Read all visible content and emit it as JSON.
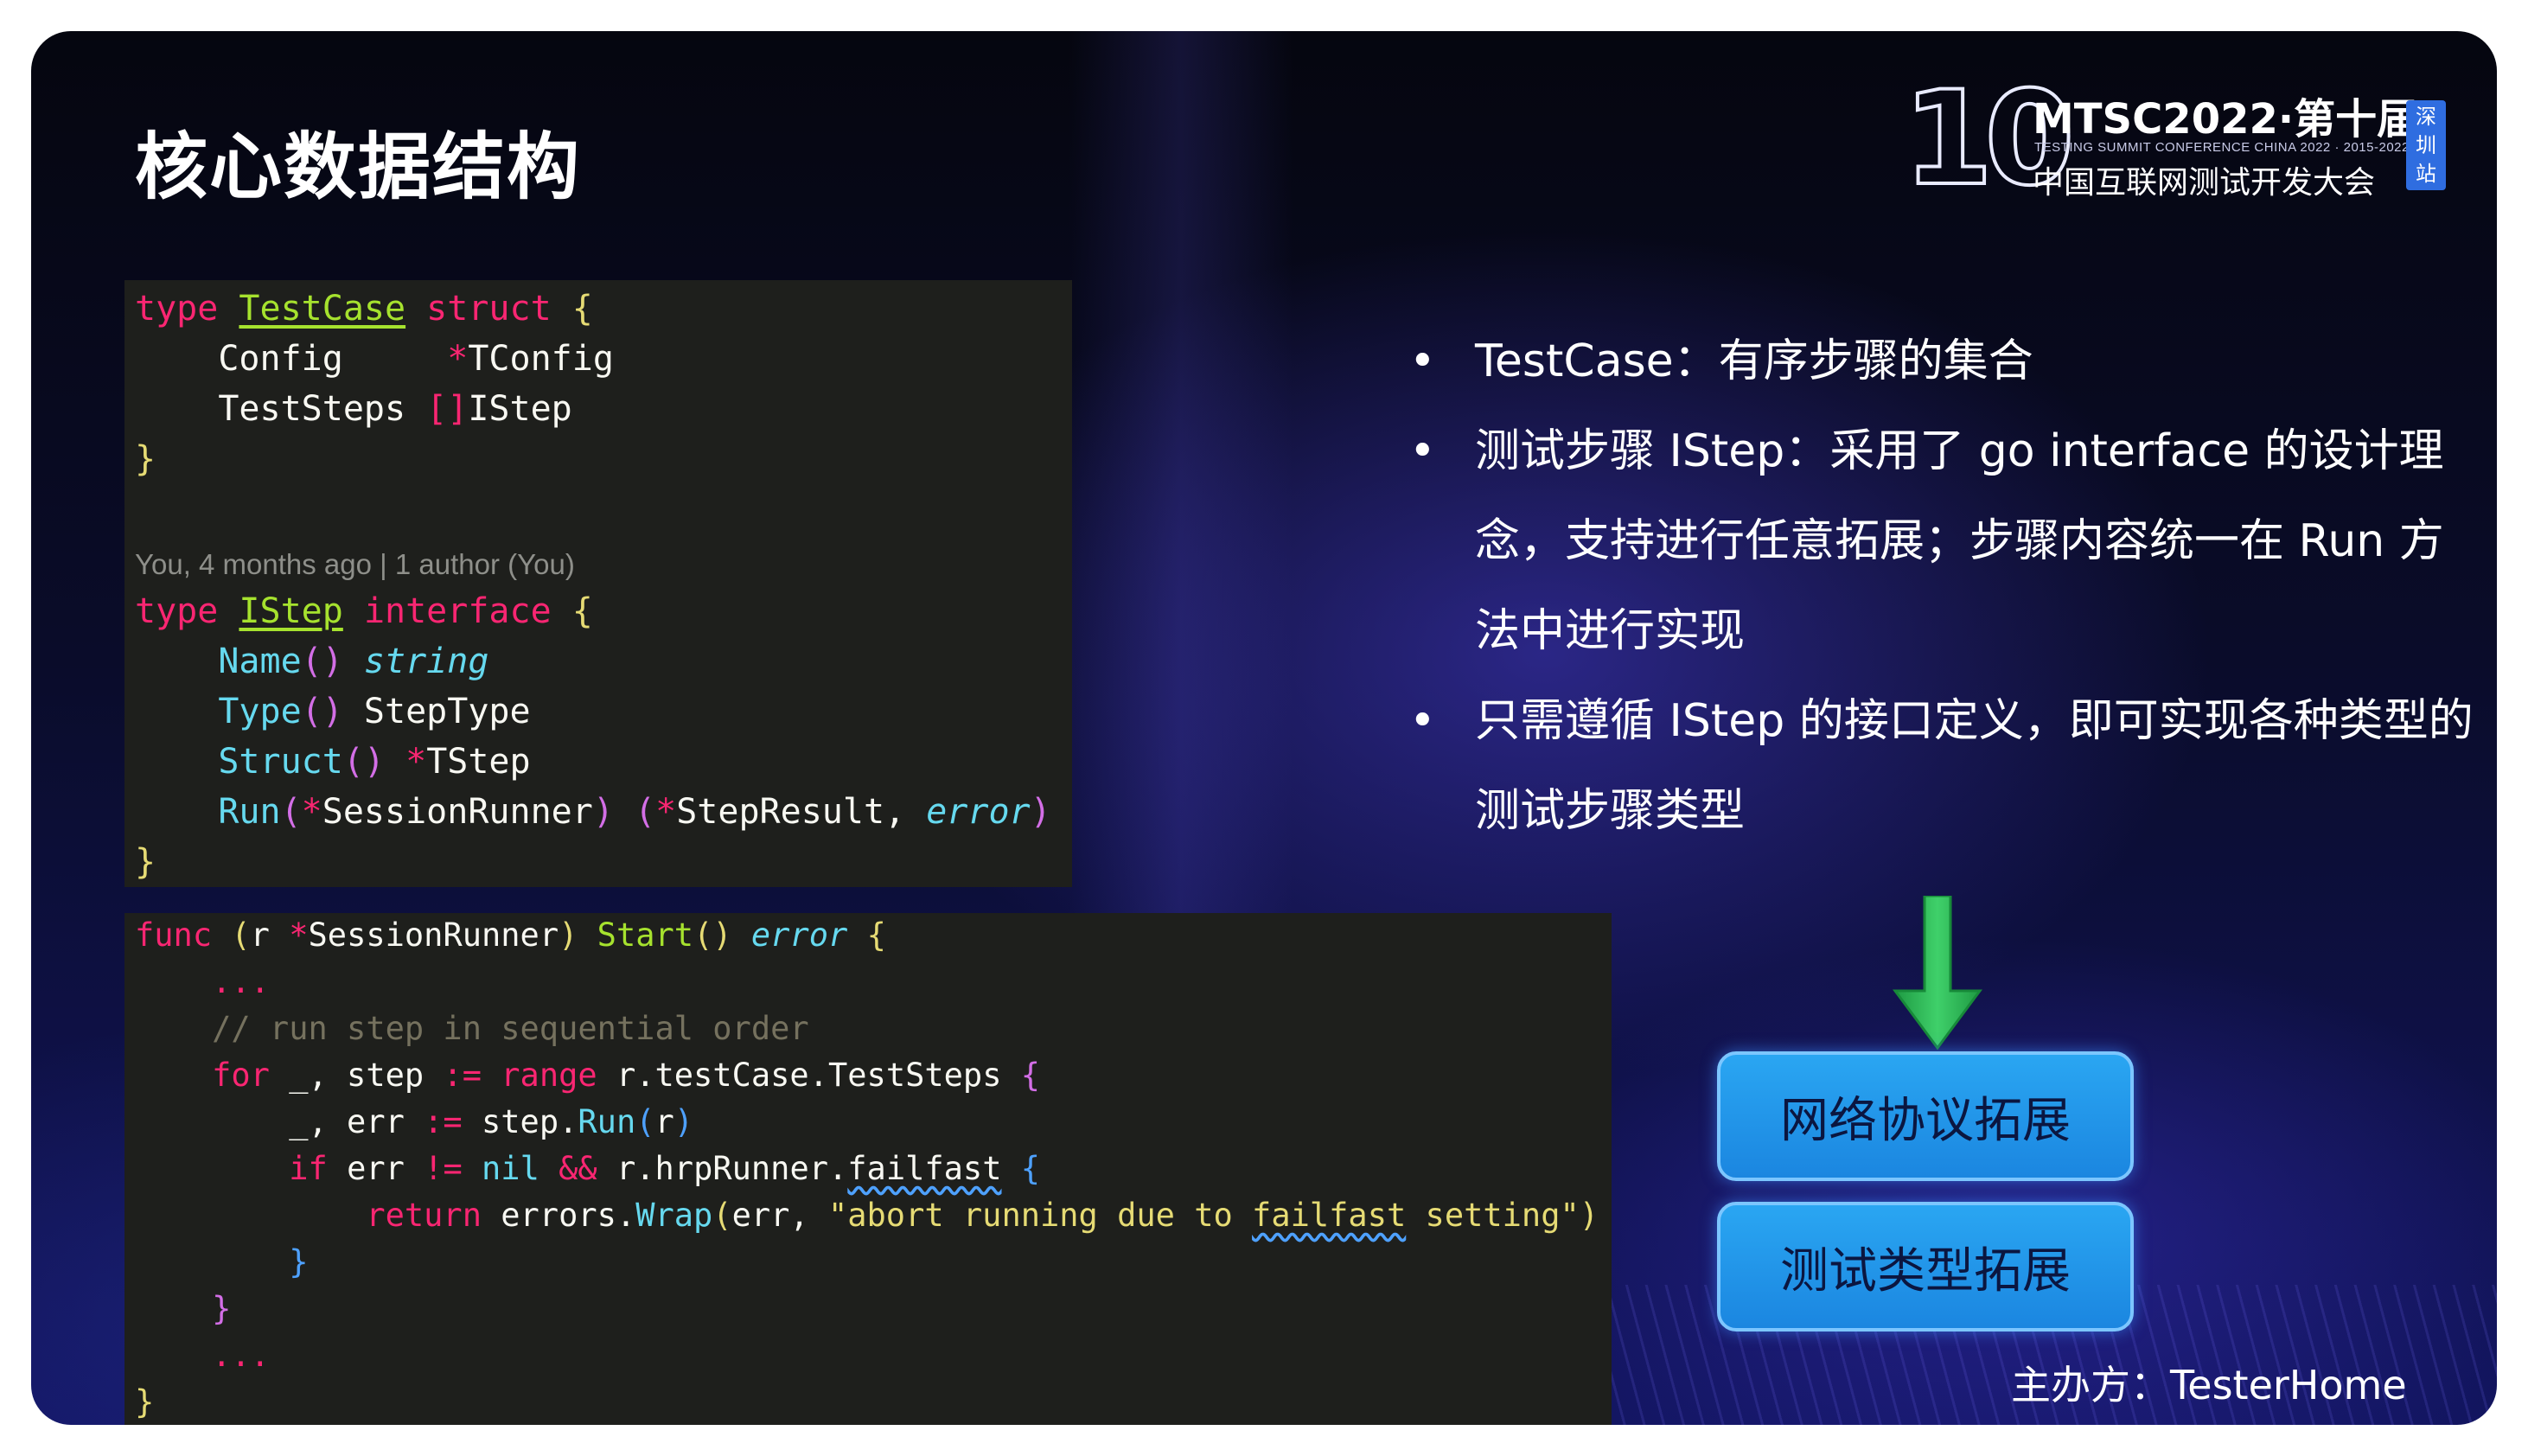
{
  "slide": {
    "title": "核心数据结构",
    "logo": {
      "brand": "MTSC2022·第十届",
      "tagline": "TESTING SUMMIT CONFERENCE CHINA 2022 · 2015-2022",
      "cn_name": "中国互联网测试开发大会",
      "edition_mark": "10",
      "badge": [
        "深",
        "圳",
        "站"
      ]
    },
    "code_testcase": {
      "lines": [
        {
          "kw": "type",
          "name": "TestCase",
          "kw2": "struct",
          "brace": "{"
        },
        {
          "field": "Config",
          "pad": "     ",
          "ptr": "*",
          "type": "TConfig"
        },
        {
          "field": "TestSteps",
          "pad": " ",
          "slice": "[]",
          "type": "IStep"
        },
        {
          "brace": "}"
        }
      ],
      "blame": "You, 4 months ago | 1 author (You)"
    },
    "code_istep": {
      "header": {
        "kw": "type",
        "name": "IStep",
        "kw2": "interface",
        "brace": "{"
      },
      "methods": [
        {
          "name": "Name",
          "parens": "()",
          "ret": "string"
        },
        {
          "name": "Type",
          "parens": "()",
          "ret": "StepType"
        },
        {
          "name": "Struct",
          "parens": "()",
          "ptr": "*",
          "ret": "TStep"
        },
        {
          "name": "Run",
          "param_ptr": "*",
          "param": "SessionRunner",
          "ret1": "StepResult",
          "ret2": "error"
        }
      ],
      "close": "}"
    },
    "code_start": {
      "l1": {
        "kw": "func",
        "recv": "r",
        "ptr": "*",
        "recv_type": "SessionRunner",
        "name": "Start",
        "ret": "error",
        "brace": "{"
      },
      "l2": "...",
      "l3": "// run step in sequential order",
      "l4": {
        "kw": "for",
        "vars": "_, step",
        "op": ":=",
        "kw2": "range",
        "expr": "r.testCase.TestSteps",
        "brace": "{"
      },
      "l5": {
        "vars": "_, err",
        "op": ":=",
        "obj": "step.",
        "call": "Run",
        "arg": "r"
      },
      "l6": {
        "kw": "if",
        "lhs": "err",
        "op": "!=",
        "nil": "nil",
        "and": "&&",
        "obj": "r.hrpRunner.",
        "field": "failfast",
        "brace": "{"
      },
      "l7": {
        "kw": "return",
        "obj": "errors.",
        "call": "Wrap",
        "arg": "err, ",
        "str_a": "\"abort running due to ",
        "str_b": "failfast",
        "str_c": " setting\""
      },
      "l8": "}",
      "l9": "}",
      "l10": "...",
      "l11": "}"
    },
    "bullets": [
      {
        "text": "TestCase：有序步骤的集合"
      },
      {
        "text": "测试步骤 IStep：采用了 go interface 的设计理念，支持进行任意拓展；步骤内容统一在 Run 方法中进行实现"
      },
      {
        "text": "只需遵循 IStep 的接口定义，即可实现各种类型的测试步骤类型"
      }
    ],
    "bullet_marker": "•",
    "buttons": [
      "网络协议拓展",
      "测试类型拓展"
    ],
    "sponsor": "主办方：TesterHome",
    "colors": {
      "keyword": "#f92672",
      "type_name": "#a6e22e",
      "function": "#66d9ef",
      "string": "#e6db74",
      "comment": "#75715e",
      "button_blue": "#1e90e8",
      "arrow_green": "#22b24c"
    },
    "icons": {
      "arrow": "down-arrow-icon"
    }
  }
}
